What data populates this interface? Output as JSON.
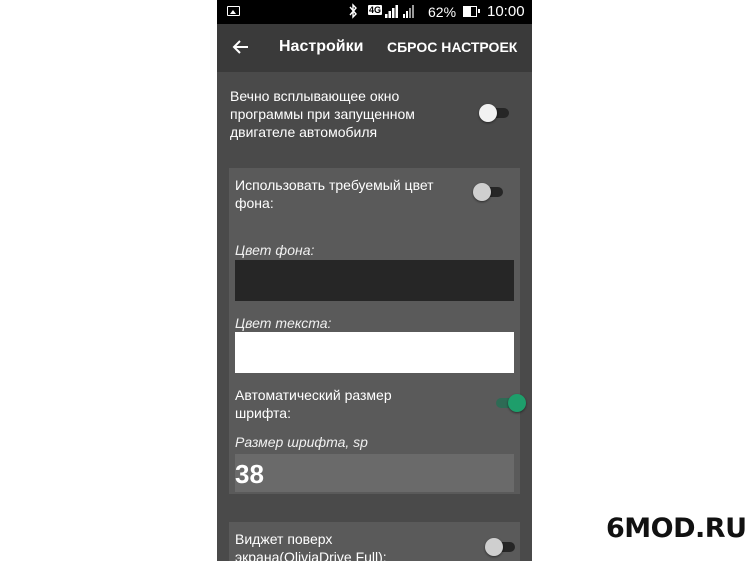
{
  "status_bar": {
    "bluetooth_icon": "bluetooth-icon",
    "network_label": "4G",
    "battery_percent": "62%",
    "time": "10:00"
  },
  "app_bar": {
    "title": "Настройки",
    "reset_label": "СБРОС НАСТРОЕК"
  },
  "settings": {
    "popup_window": {
      "label": "Вечно всплывающее окно программы при запущенном двигателе автомобиля",
      "enabled": false
    },
    "use_bg_color": {
      "label": "Использовать требуемый цвет фона:",
      "enabled": false
    },
    "bg_color": {
      "label": "Цвет фона:",
      "value_color": "#262626"
    },
    "text_color": {
      "label": "Цвет текста:",
      "value_color": "#ffffff"
    },
    "auto_font_size": {
      "label": "Автоматический размер шрифта:",
      "enabled": true
    },
    "font_size": {
      "label": "Размер шрифта, sp",
      "value": "38"
    },
    "widget_overlay": {
      "label": "Виджет поверх экрана(OliviaDrive Full):",
      "enabled": false
    }
  },
  "colors": {
    "accent": "#1e9e6b",
    "background": "#4a4a4a",
    "card": "#5a5a5a"
  },
  "watermark": "6MOD.RU"
}
